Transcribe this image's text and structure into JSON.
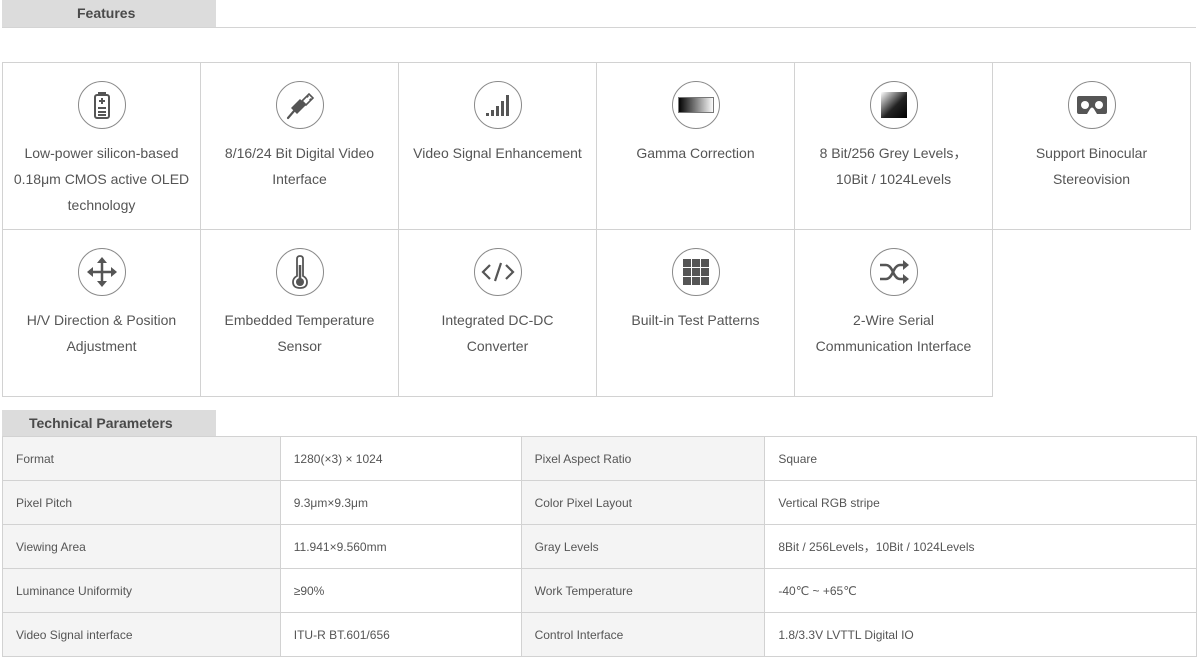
{
  "features_section": {
    "title": "Features"
  },
  "features": [
    {
      "icon": "battery-icon",
      "label": "Low-power silicon-based 0.18μm CMOS active OLED technology"
    },
    {
      "icon": "usb-cable-icon",
      "label": "8/16/24 Bit Digital Video Interface"
    },
    {
      "icon": "signal-bars-icon",
      "label": "Video Signal Enhancement"
    },
    {
      "icon": "gradient-bar-icon",
      "label": "Gamma Correction"
    },
    {
      "icon": "gradient-square-icon",
      "label": "8 Bit/256 Grey Levels，10Bit / 1024Levels"
    },
    {
      "icon": "vr-headset-icon",
      "label": "Support Binocular Stereovision"
    },
    {
      "icon": "move-arrows-icon",
      "label": "H/V Direction & Position Adjustment"
    },
    {
      "icon": "thermometer-icon",
      "label": "Embedded Temperature Sensor"
    },
    {
      "icon": "code-icon",
      "label": "Integrated DC-DC Converter"
    },
    {
      "icon": "grid-icon",
      "label": "Built-in Test Patterns"
    },
    {
      "icon": "shuffle-icon",
      "label": "2-Wire Serial Communication Interface"
    }
  ],
  "tech_section": {
    "title": "Technical Parameters"
  },
  "params": [
    [
      "Format",
      "1280(×3) × 1024",
      "Pixel Aspect Ratio",
      "Square"
    ],
    [
      "Pixel Pitch",
      "9.3μm×9.3μm",
      "Color Pixel Layout",
      "Vertical RGB stripe"
    ],
    [
      "Viewing Area",
      "11.941×9.560mm",
      "Gray Levels",
      "8Bit / 256Levels，10Bit / 1024Levels"
    ],
    [
      "Luminance Uniformity",
      "≥90%",
      "Work Temperature",
      "-40℃ ~ +65℃"
    ],
    [
      "Video Signal interface",
      "ITU-R BT.601/656",
      "Control Interface",
      "1.8/3.3V LVTTL Digital IO"
    ]
  ]
}
